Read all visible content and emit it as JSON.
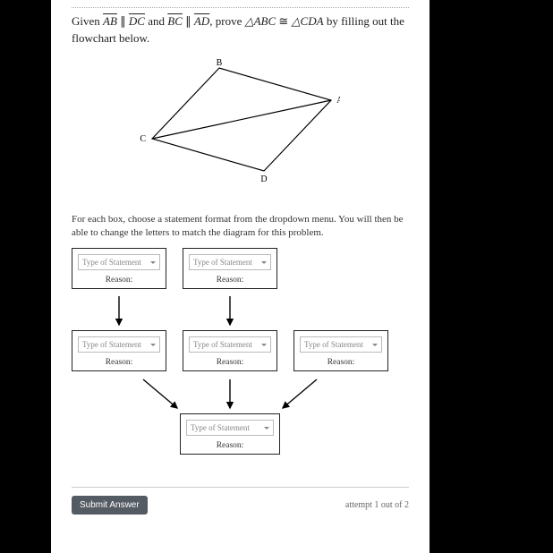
{
  "problem": {
    "given_prefix": "Given ",
    "seg1": "AB",
    "par1": " ∥ ",
    "seg2": "DC",
    "mid1": " and ",
    "seg3": "BC",
    "par2": " ∥ ",
    "seg4": "AD",
    "prove_prefix": ", prove ",
    "tri1": "△ABC",
    "cong": " ≅ ",
    "tri2": "△CDA",
    "suffix": " by filling out the flowchart below."
  },
  "labels": {
    "A": "A",
    "B": "B",
    "C": "C",
    "D": "D"
  },
  "instructions": "For each box, choose a statement format from the dropdown menu. You will then be able to change the letters to match the diagram for this problem.",
  "dropdown_placeholder": "Type of Statement",
  "reason_label": "Reason:",
  "submit_label": "Submit Answer",
  "attempt_text": "attempt 1 out of 2"
}
